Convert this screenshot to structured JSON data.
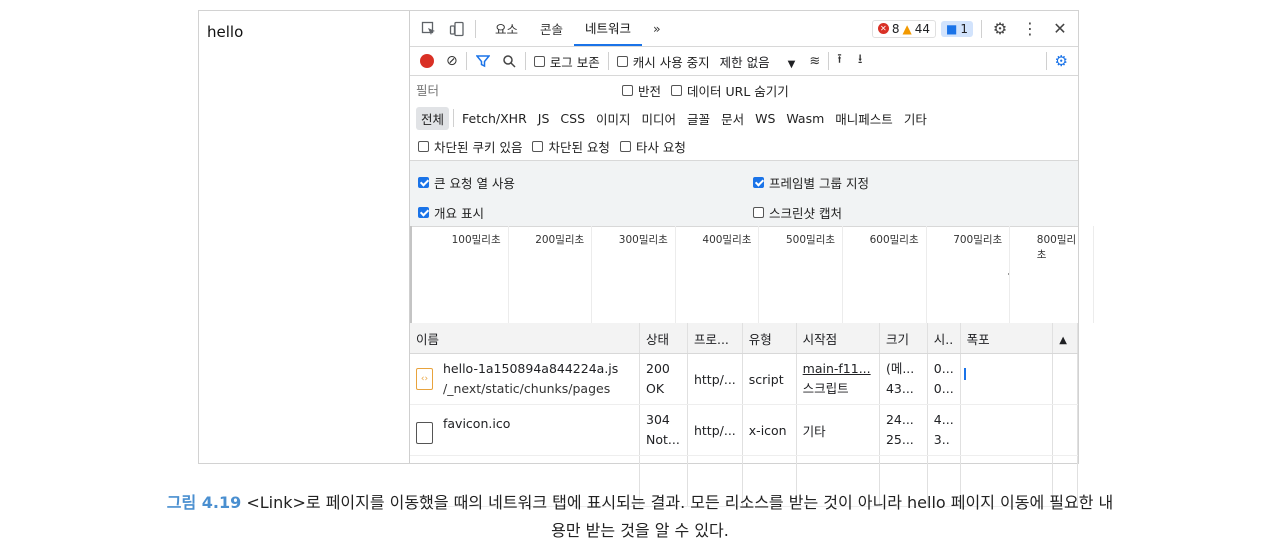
{
  "page": {
    "text": "hello"
  },
  "tabs": {
    "elements": "요소",
    "console": "콘솔",
    "network": "네트워크",
    "more": "»"
  },
  "counts": {
    "errors": "8",
    "warnings": "44",
    "messages": "1"
  },
  "toolbar": {
    "preserve_log": "로그 보존",
    "disable_cache": "캐시 사용 중지",
    "throttle": "제한 없음"
  },
  "filter": {
    "placeholder": "필터",
    "invert": "반전",
    "hide_data_urls": "데이터 URL 숨기기"
  },
  "types": [
    "전체",
    "Fetch/XHR",
    "JS",
    "CSS",
    "이미지",
    "미디어",
    "글꼴",
    "문서",
    "WS",
    "Wasm",
    "매니페스트",
    "기타"
  ],
  "blocked": {
    "cookies": "차단된 쿠키 있음",
    "requests": "차단된 요청",
    "third_party": "타사 요청"
  },
  "settings": {
    "big_rows": "큰 요청 열 사용",
    "group_by_frame": "프레임별 그룹 지정",
    "overview": "개요 표시",
    "screenshots": "스크린샷 캡처"
  },
  "timeline_ticks": [
    "100밀리초",
    "200밀리초",
    "300밀리초",
    "400밀리초",
    "500밀리초",
    "600밀리초",
    "700밀리초",
    "800밀리초"
  ],
  "table": {
    "headers": [
      "이름",
      "상태",
      "프로...",
      "유형",
      "시작점",
      "크기",
      "시..",
      "폭포"
    ],
    "rows": [
      {
        "name": "hello-1a150894a844224a.js",
        "path": "/_next/static/chunks/pages",
        "status": "200",
        "status_text": "OK",
        "protocol": "http/...",
        "type": "script",
        "initiator": "main-f11...",
        "initiator_sub": "스크립트",
        "size": "(메...",
        "size_sub": "43...",
        "time": "0...",
        "time_sub": "0..."
      },
      {
        "name": "favicon.ico",
        "path": "",
        "status": "304",
        "status_text": "Not...",
        "protocol": "http/...",
        "type": "x-icon",
        "initiator": "기타",
        "initiator_sub": "",
        "size": "24...",
        "size_sub": "25...",
        "time": "4...",
        "time_sub": "3.."
      }
    ]
  },
  "caption": {
    "label": "그림 4.19",
    "line1": "<Link>로 페이지를 이동했을 때의 네트워크 탭에 표시되는 결과. 모든 리소스를 받는 것이 아니라 hello 페이지 이동에 필요한 내",
    "line2": "용만 받는 것을 알 수 있다."
  },
  "colors": {
    "accent": "#1a73e8",
    "record": "#d93025",
    "error": "#d93025",
    "warning": "#f29900",
    "caption_label": "#4a8fd0"
  }
}
